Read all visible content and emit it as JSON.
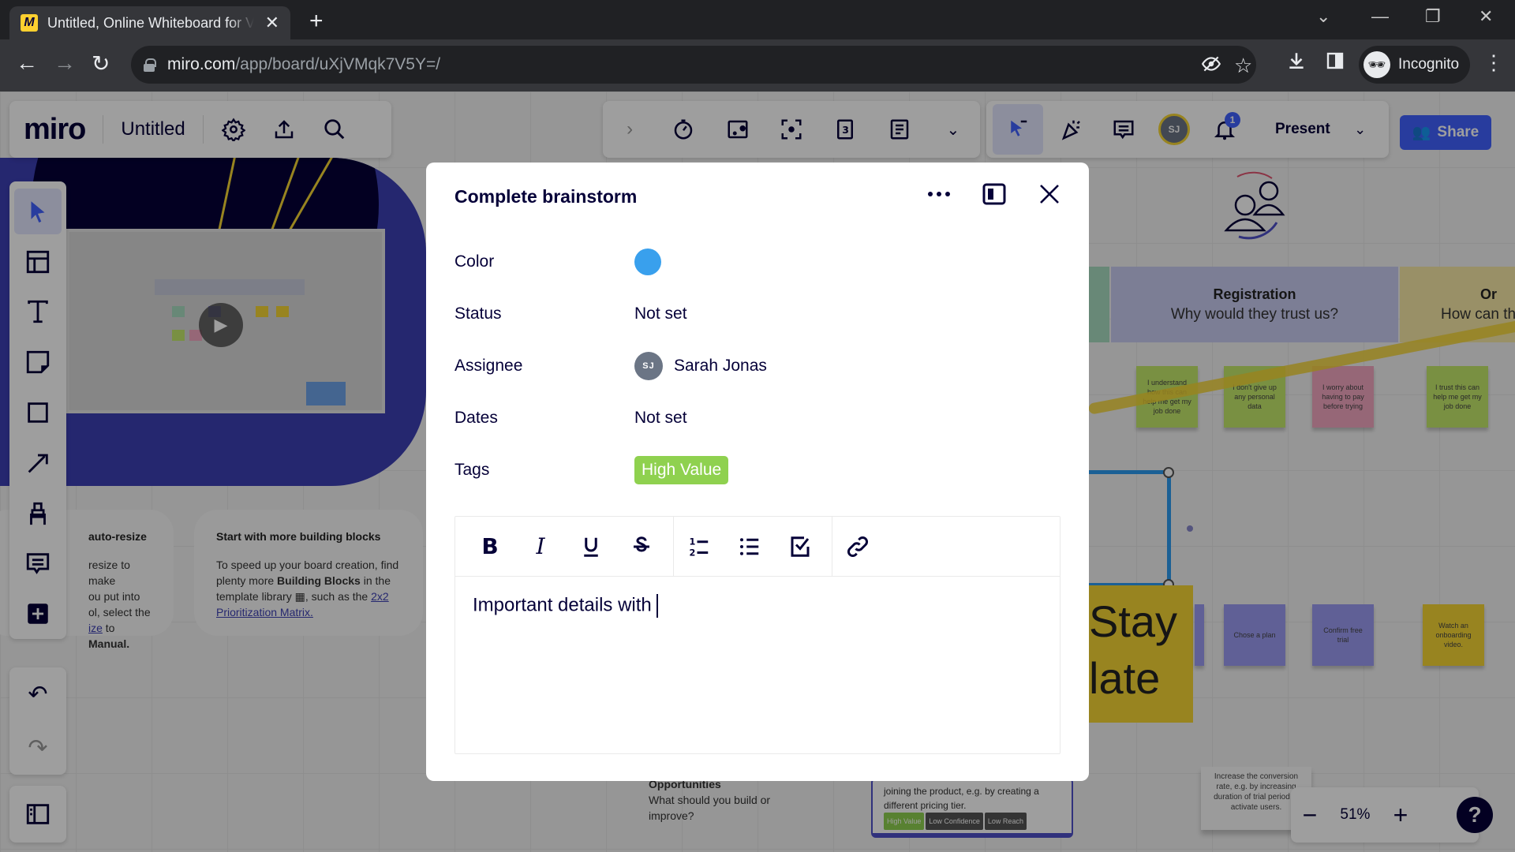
{
  "browser": {
    "tab_title": "Untitled, Online Whiteboard for Visual Collaboration",
    "tab_favicon": "miro-logo",
    "url_host": "miro.com",
    "url_path": "/app/board/uXjVMqk7V5Y=/",
    "profile_label": "Incognito",
    "icons": [
      "back-icon",
      "forward-icon",
      "reload-icon",
      "lock-icon",
      "eye-slash-icon",
      "star-icon",
      "download-icon",
      "side-panel-icon",
      "incognito-icon",
      "more-vert-icon"
    ]
  },
  "miro": {
    "logo": "miro",
    "board_name": "Untitled",
    "present_label": "Present",
    "share_label": "Share",
    "user_initials": "SJ",
    "notification_count": "1",
    "zoom_level": "51%",
    "help_label": "?",
    "left_tools": [
      "select",
      "templates",
      "text",
      "sticky-note",
      "shape",
      "connection-line",
      "pen",
      "comment",
      "more-apps"
    ]
  },
  "board": {
    "cards": [
      {
        "title": "auto-resize",
        "lines": [
          "resize to make",
          "ou put into",
          "ol, select the"
        ],
        "link": "ize",
        "tail": " to ",
        "bold_tail": "Manual."
      },
      {
        "title": "Start with more building blocks",
        "p1": "To speed up your board creation, find plenty more ",
        "bold": "Building Blocks",
        "p2": " in the template library ",
        "p3": ", such as the ",
        "link": "2x2 Prioritization Matrix."
      }
    ],
    "stages": [
      {
        "title": "Registration",
        "subtitle": "Why would they trust us?"
      },
      {
        "title": "Or",
        "subtitle": "How can th"
      }
    ],
    "stickies_row1": [
      {
        "text": "I understand how this can help me get my job done",
        "color": "#c4e86b"
      },
      {
        "text": "I don't give up any personal data",
        "color": "#c4e86b"
      },
      {
        "text": "I worry about having to pay before trying",
        "color": "#f2a7c0"
      },
      {
        "text": "I trust this can help me get my job done",
        "color": "#c4e86b"
      }
    ],
    "stickies_row2": [
      {
        "text": "Chose a plan",
        "color": "#9c9bf2"
      },
      {
        "text": "Confirm free trial",
        "color": "#9c9bf2"
      },
      {
        "text": "Watch an onboarding video.",
        "color": "#f5d535"
      }
    ],
    "big_sticky_text": [
      "Stay",
      "late"
    ],
    "opportunities": {
      "title": "Opportunities",
      "subtitle": "What should you build or improve?"
    },
    "opp_card": {
      "text": "joining the product, e.g. by creating a different pricing tier.",
      "tags": [
        {
          "label": "High Value",
          "color": "#8fd14f"
        },
        {
          "label": "Low Confidence",
          "color": "#555555"
        },
        {
          "label": "Low Reach",
          "color": "#555555"
        }
      ]
    },
    "note_card": "Increase the conversion rate, e.g. by increasing duration of trial period to activate users."
  },
  "modal": {
    "title": "Complete brainstorm",
    "properties": [
      {
        "label": "Color",
        "type": "color",
        "value": "#39a0ed"
      },
      {
        "label": "Status",
        "type": "text",
        "value": "Not set"
      },
      {
        "label": "Assignee",
        "type": "user",
        "initials": "SJ",
        "value": "Sarah Jonas"
      },
      {
        "label": "Dates",
        "type": "text",
        "value": "Not set"
      },
      {
        "label": "Tags",
        "type": "tag",
        "value": "High Value",
        "color": "#8fd14f"
      }
    ],
    "editor_tools": [
      "bold",
      "italic",
      "underline",
      "strikethrough",
      "numbered-list",
      "bulleted-list",
      "checklist",
      "link"
    ],
    "editor_text": "Important details with"
  }
}
